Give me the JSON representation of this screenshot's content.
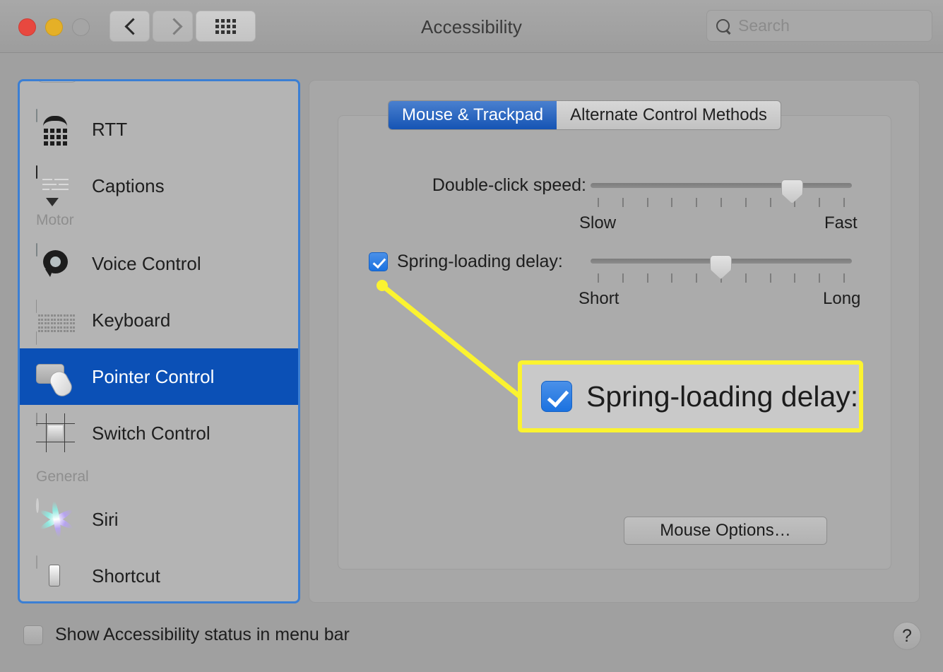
{
  "window": {
    "title": "Accessibility",
    "traffic_lights": [
      "close",
      "minimize",
      "zoom"
    ],
    "back_label": "Back",
    "forward_label": "Forward",
    "grid_label": "Show All"
  },
  "search": {
    "placeholder": "Search",
    "value": ""
  },
  "sidebar": {
    "items": [
      {
        "label": "RTT",
        "icon": "rtt-icon",
        "selected": false,
        "group": null
      },
      {
        "label": "Captions",
        "icon": "captions-icon",
        "selected": false,
        "group": null
      },
      {
        "label": "Voice Control",
        "icon": "voice-control-icon",
        "selected": false,
        "group": "Motor"
      },
      {
        "label": "Keyboard",
        "icon": "keyboard-icon",
        "selected": false,
        "group": null
      },
      {
        "label": "Pointer Control",
        "icon": "pointer-control-icon",
        "selected": true,
        "group": null
      },
      {
        "label": "Switch Control",
        "icon": "switch-control-icon",
        "selected": false,
        "group": null
      },
      {
        "label": "Siri",
        "icon": "siri-icon",
        "selected": false,
        "group": "General"
      },
      {
        "label": "Shortcut",
        "icon": "shortcut-icon",
        "selected": false,
        "group": null
      }
    ],
    "groups": [
      {
        "label": "Motor"
      },
      {
        "label": "General"
      }
    ],
    "selection_color": "#0b50b6",
    "focus_ring_color": "#3b7fd4"
  },
  "main": {
    "tabs": [
      {
        "label": "Mouse & Trackpad",
        "active": true
      },
      {
        "label": "Alternate Control Methods",
        "active": false
      }
    ],
    "double_click_speed": {
      "label": "Double-click speed:",
      "min_label": "Slow",
      "max_label": "Fast",
      "tick_count": 11,
      "value_percent": 77
    },
    "spring_loading_delay": {
      "label": "Spring-loading delay:",
      "checked": true,
      "min_label": "Short",
      "max_label": "Long",
      "tick_count": 11,
      "value_percent": 50
    },
    "mouse_options_button": "Mouse Options…"
  },
  "callout": {
    "checkbox_checked": true,
    "text": "Spring-loading delay:",
    "highlight_color": "#fbf330",
    "box_background": "#c9c9c9"
  },
  "footer": {
    "show_status_label": "Show Accessibility status in menu bar",
    "show_status_checked": false,
    "help_label": "?"
  }
}
